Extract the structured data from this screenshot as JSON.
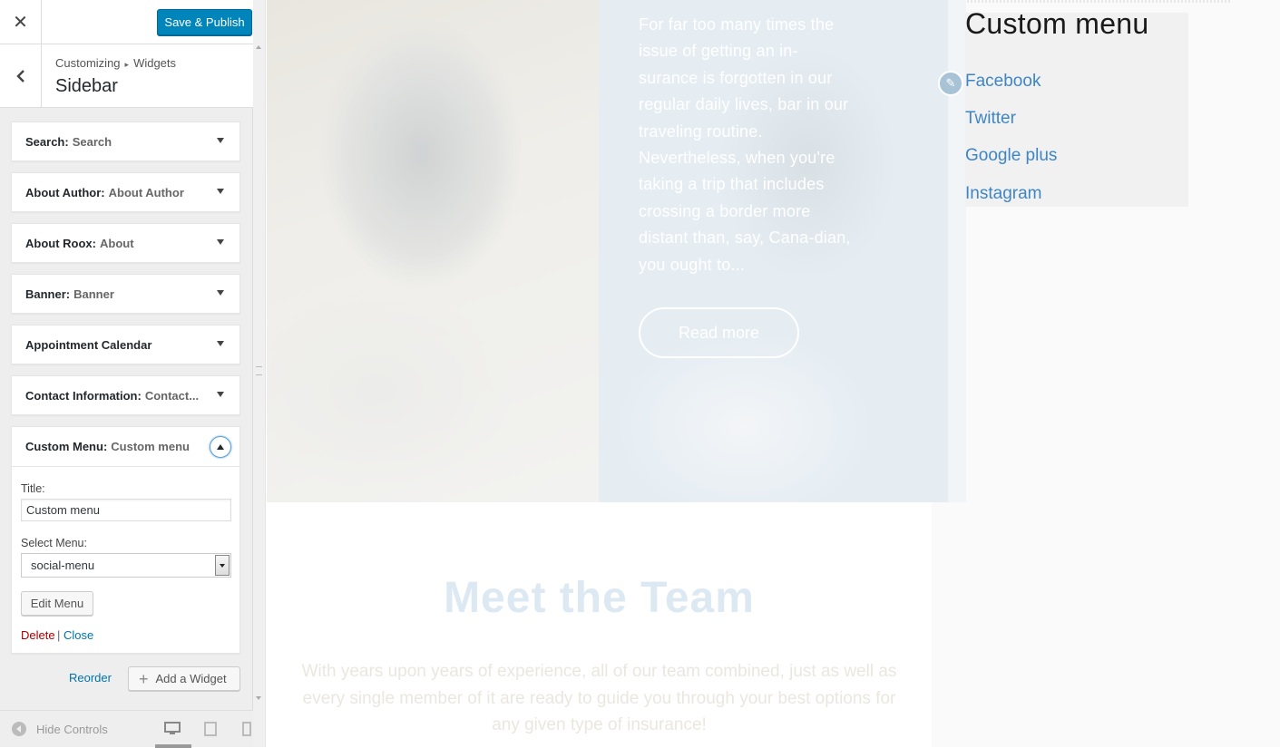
{
  "topbar": {
    "close_glyph": "✕",
    "save_label": "Save & Publish"
  },
  "section": {
    "breadcrumb_root": "Customizing",
    "breadcrumb_child": "Widgets",
    "title": "Sidebar"
  },
  "widgets": [
    {
      "name": "Search:",
      "title": "Search"
    },
    {
      "name": "About Author:",
      "title": "About Author"
    },
    {
      "name": "About Roox:",
      "title": "About"
    },
    {
      "name": "Banner:",
      "title": "Banner"
    },
    {
      "name": "Appointment Calendar",
      "title": ""
    },
    {
      "name": "Contact Information:",
      "title": "Contact..."
    }
  ],
  "custom_widget": {
    "name": "Custom Menu:",
    "title": "Custom menu",
    "title_label": "Title:",
    "title_value": "Custom menu",
    "select_label": "Select Menu:",
    "select_value": "social-menu",
    "edit_menu_label": "Edit Menu",
    "delete_label": "Delete",
    "separator": "|",
    "close_label": "Close"
  },
  "actions": {
    "reorder_label": "Reorder",
    "add_widget_label": "Add a Widget"
  },
  "footer": {
    "hide_controls_label": "Hide Controls"
  },
  "preview": {
    "hero_text": "For far too many times the issue of getting an in-surance is forgotten in our regular daily lives, bar in our traveling routine. Nevertheless, when you're taking a trip that includes crossing a border more distant than, say, Cana-dian, you ought to...",
    "read_more_label": "Read more",
    "custom_menu_title": "Custom menu",
    "menu_links": [
      "Facebook",
      "Twitter",
      "Google plus",
      "Instagram"
    ],
    "team_title": "Meet the Team",
    "team_text": "With years upon years of experience, all of our team combined, just as well as every single member of it are ready to guide you through your best options for any given type of insurance!"
  },
  "colors": {
    "accent": "#0085ba",
    "link": "#0073aa",
    "delete": "#a00",
    "menu_link": "#1e73be"
  }
}
